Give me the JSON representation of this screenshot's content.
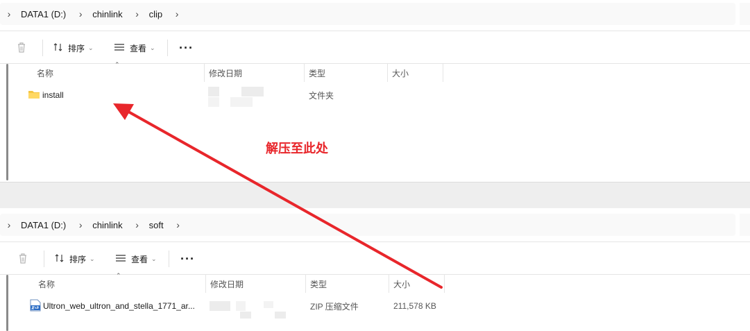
{
  "top_window": {
    "breadcrumb": [
      "DATA1 (D:)",
      "chinlink",
      "clip"
    ],
    "toolbar": {
      "sort_label": "排序",
      "view_label": "查看",
      "more_label": "···"
    },
    "columns": {
      "name": "名称",
      "modified": "修改日期",
      "type": "类型",
      "size": "大小"
    },
    "rows": [
      {
        "name": "install",
        "type": "文件夹",
        "size": "",
        "icon": "folder-icon"
      }
    ]
  },
  "bottom_window": {
    "breadcrumb": [
      "DATA1 (D:)",
      "chinlink",
      "soft"
    ],
    "toolbar": {
      "sort_label": "排序",
      "view_label": "查看",
      "more_label": "···"
    },
    "columns": {
      "name": "名称",
      "modified": "修改日期",
      "type": "类型",
      "size": "大小"
    },
    "rows": [
      {
        "name": "Ultron_web_ultron_and_stella_1771_ar...",
        "type": "ZIP 压缩文件",
        "size": "211,578 KB",
        "icon": "zip-icon"
      }
    ]
  },
  "annotation": {
    "text": "解压至此处",
    "color": "#e8262b"
  },
  "colors": {
    "arrow": "#e8262b",
    "folder": "#f4c542",
    "zip": "#2b6cc4"
  }
}
